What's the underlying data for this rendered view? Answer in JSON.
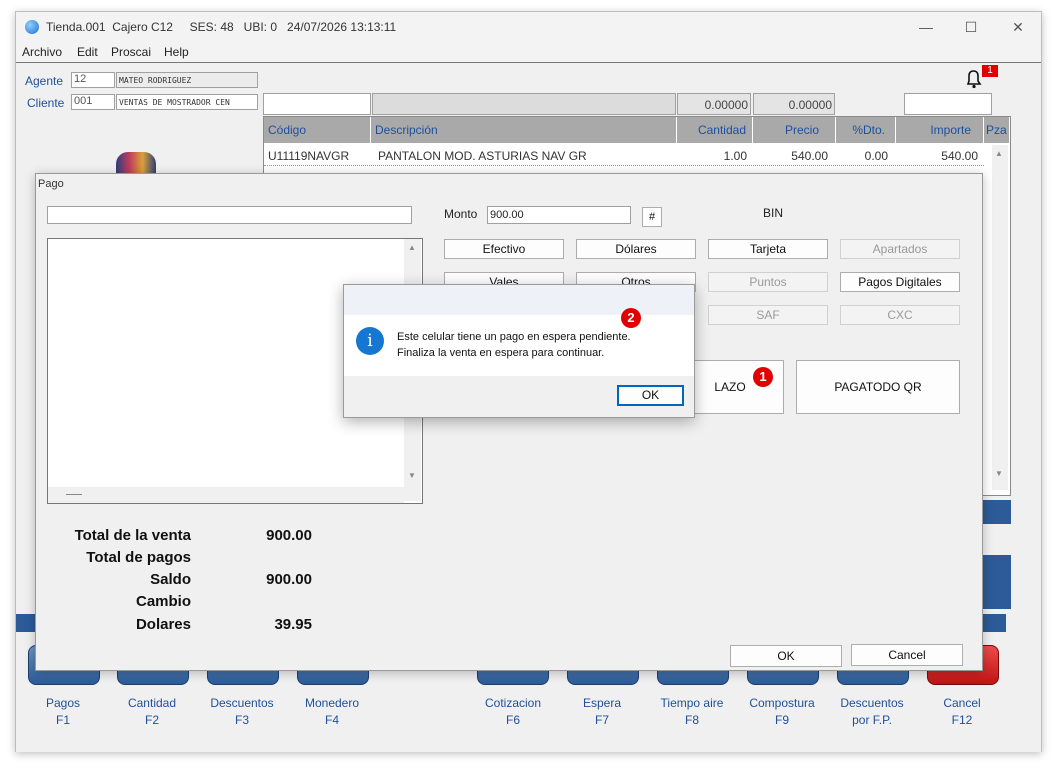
{
  "window": {
    "title": "Tienda.001  Cajero C12     SES: 48   UBI: 0   24/07/2026 13:13:11",
    "minimize": "—",
    "maximize": "☐",
    "close": "✕"
  },
  "menu": [
    "Archivo",
    "Edit",
    "Proscai",
    "Help"
  ],
  "header": {
    "agente_label": "Agente",
    "agente_code": "12",
    "agente_name": "MATEO RODRIGUEZ",
    "cliente_label": "Cliente",
    "cliente_code": "001",
    "cliente_name": "VENTAS DE MOSTRADOR CEN",
    "field_value_1": "0.00000",
    "field_value_2": "0.00000",
    "notification_count": "1"
  },
  "grid": {
    "columns": [
      "Código",
      "Descripción",
      "Cantidad",
      "Precio",
      "%Dto.",
      "Importe",
      "Pza"
    ],
    "rows": [
      [
        "U11119NAVGR",
        "PANTALON MOD. ASTURIAS NAV GR",
        "1.00",
        "540.00",
        "0.00",
        "540.00"
      ]
    ]
  },
  "pago": {
    "title": "Pago",
    "monto_label": "Monto",
    "monto_value": "900.00",
    "hash_button": "#",
    "bin_label": "BIN",
    "buttons": {
      "efectivo": "Efectivo",
      "dolares": "Dólares",
      "tarjeta": "Tarjeta",
      "apartados": "Apartados",
      "vales": "Vales",
      "otros": "Otros",
      "puntos": "Puntos",
      "pagos_digitales": "Pagos Digitales",
      "saf": "SAF",
      "cxc": "CXC",
      "plazo": "LAZO",
      "pagatodo": "PAGATODO QR"
    },
    "totals": [
      {
        "label": "Total de la venta",
        "value": "900.00"
      },
      {
        "label": "Total de pagos",
        "value": ""
      },
      {
        "label": "Saldo",
        "value": "900.00"
      },
      {
        "label": "Cambio",
        "value": ""
      },
      {
        "label": "Dolares",
        "value": "39.95"
      }
    ],
    "ok": "OK",
    "cancel": "Cancel"
  },
  "message": {
    "line1": "Este celular tiene un pago en espera pendiente.",
    "line2": "Finaliza la venta en espera para continuar.",
    "ok": "OK",
    "badge_dialog": "2",
    "badge_button": "1"
  },
  "fkeys": [
    {
      "name": "Pagos",
      "key": "F1"
    },
    {
      "name": "Cantidad",
      "key": "F2"
    },
    {
      "name": "Descuentos",
      "key": "F3"
    },
    {
      "name": "Monedero",
      "key": "F4"
    },
    {
      "name": "Cotizacion",
      "key": "F6"
    },
    {
      "name": "Espera",
      "key": "F7"
    },
    {
      "name": "Tiempo aire",
      "key": "F8"
    },
    {
      "name": "Compostura",
      "key": "F9"
    },
    {
      "name": "Descuentos",
      "key": "por F.P."
    },
    {
      "name": "Cancel",
      "key": "F12"
    }
  ],
  "colors": {
    "accent_blue": "#1f4f9a",
    "badge_red": "#e00000",
    "fkey_blue": "#2c5b98",
    "fkey_cancel": "#d21d1d"
  }
}
